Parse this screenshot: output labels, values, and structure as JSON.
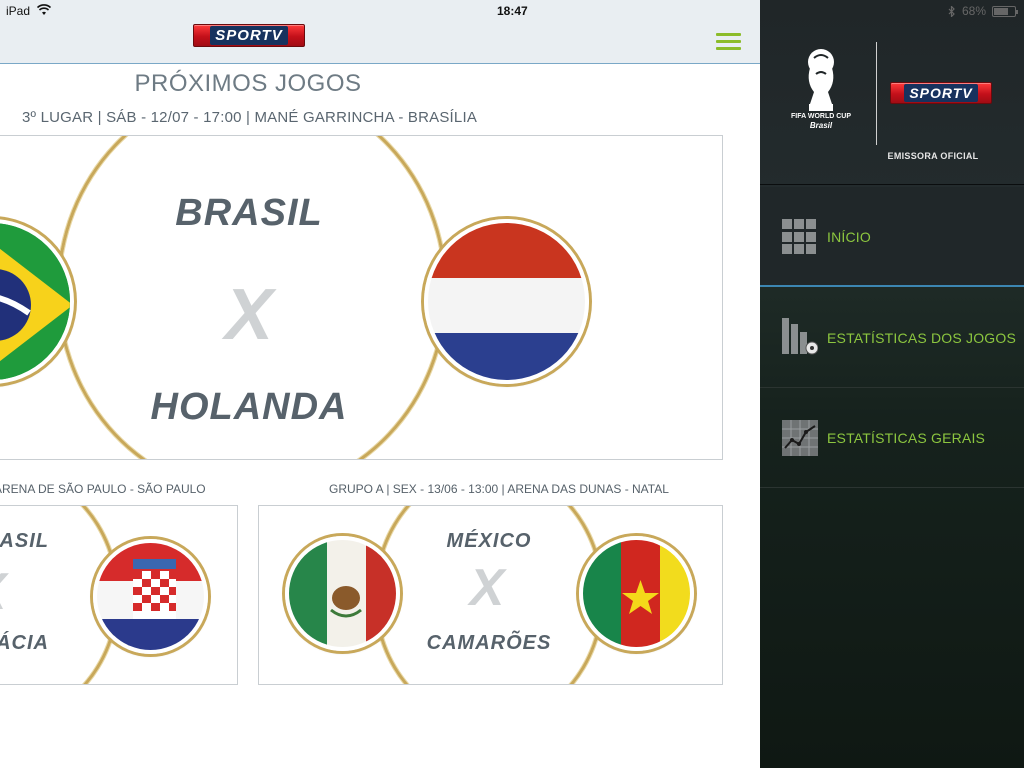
{
  "status_bar": {
    "carrier": "iPad",
    "time": "18:47",
    "battery": "68%"
  },
  "header": {
    "logo_text": "SPORTV"
  },
  "main": {
    "title": "PRÓXIMOS JOGOS",
    "featured": {
      "info": "3º LUGAR | SÁB - 12/07 - 17:00 | MANÉ GARRINCHA - BRASÍLIA",
      "home": "BRASIL",
      "away": "HOLANDA",
      "vs": "X"
    },
    "matches": [
      {
        "info": "ARENA DE SÃO PAULO - SÃO PAULO",
        "home": "BRASIL",
        "away": "CROÁCIA",
        "vs": "X"
      },
      {
        "info": "GRUPO A | SEX - 13/06 - 13:00 | ARENA DAS DUNAS - NATAL",
        "home": "MÉXICO",
        "away": "CAMARÕES",
        "vs": "X"
      }
    ]
  },
  "menu": {
    "brand": {
      "fifa_line1": "FIFA WORLD CUP",
      "fifa_line2": "Brasil",
      "sportv": "SPORTV",
      "tagline": "EMISSORA OFICIAL"
    },
    "items": [
      {
        "label": "INÍCIO",
        "icon": "grid-icon"
      },
      {
        "label": "ESTATÍSTICAS DOS JOGOS",
        "icon": "bar-chart-ball-icon"
      },
      {
        "label": "ESTATÍSTICAS GERAIS",
        "icon": "line-chart-icon"
      }
    ]
  },
  "colors": {
    "accent_green": "#8cc63f",
    "sportv_red": "#d0141c",
    "gold_ring": "#c8a85a",
    "team_text": "#57626b",
    "menu_bg": "#1c2426"
  }
}
